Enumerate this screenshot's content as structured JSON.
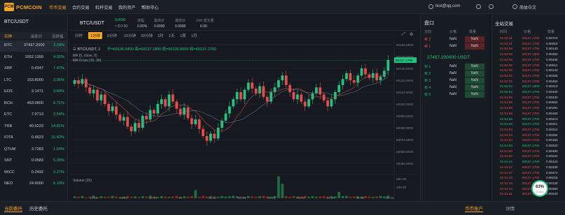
{
  "app": {
    "logo_text": "PCMCOIN",
    "logo_mark": "PCM"
  },
  "nav": [
    "币币交易",
    "合约交易",
    "杠杆交易",
    "我的资产",
    "帮助中心"
  ],
  "nav_active_index": 0,
  "header_right": {
    "user": "test@qq.com",
    "lang": "简体中文",
    "extra": ""
  },
  "market": {
    "title": "BTC/USDT",
    "headers": [
      "币种",
      "最新价",
      "涨跌幅"
    ],
    "rows": [
      {
        "coin": "BTC",
        "price": "37497.2000",
        "change": "2.24%"
      },
      {
        "coin": "ETH",
        "price": "1652.1300",
        "change": "4.92%"
      },
      {
        "coin": "XRP",
        "price": "0.4347",
        "change": "7.47%"
      },
      {
        "coin": "LTC",
        "price": "153.8000",
        "change": "3.05%"
      },
      {
        "coin": "EOS",
        "price": "3.1471",
        "change": "3.69%"
      },
      {
        "coin": "BCH",
        "price": "463.0800",
        "change": "6.71%"
      },
      {
        "coin": "ETC",
        "price": "7.9713",
        "change": "3.54%"
      },
      {
        "coin": "TRB",
        "price": "40.5223",
        "change": "14.81%"
      },
      {
        "coin": "IOTA",
        "price": "0.4823",
        "change": "15.42%"
      },
      {
        "coin": "QTUM",
        "price": "3.7383",
        "change": "1.64%"
      },
      {
        "coin": "SNT",
        "price": "0.0583",
        "change": "5.39%"
      },
      {
        "coin": "WICC",
        "price": "0.2492",
        "change": "3.27%"
      },
      {
        "coin": "NEO",
        "price": "24.6000",
        "change": "6.19%"
      }
    ]
  },
  "pair": {
    "title": "BTC/USDT",
    "price": "0.0000",
    "price_usd": "≈ $ 0.00",
    "stats": [
      {
        "k": "涨幅",
        "v": "0.00%"
      },
      {
        "k": "最高价",
        "v": "0.0000"
      },
      {
        "k": "最低价",
        "v": "0.0000"
      },
      {
        "k": "24H 成交量",
        "v": "0.00"
      }
    ]
  },
  "timeframes": [
    "分时",
    "1分钟",
    "5分钟",
    "15分钟",
    "30分钟",
    "1时",
    "1天",
    "1周",
    "1月"
  ],
  "timeframe_active_index": 1,
  "tv": {
    "legend": "BTC/USDT, 1",
    "ohlc": "开=60136.5400 高=60137.1800 低=60135.8600 收=60137.1700",
    "ma1": "MA (5, close, 0)",
    "ma2": "MA Cross (10, 30)",
    "volume": "Volume (20)"
  },
  "chart_data": {
    "type": "candlestick",
    "y_ticks": [
      "60150.0000",
      "60140.0000",
      "60130.0000",
      "60120.0000",
      "60110.0000",
      "60100.0000",
      "60090.0000",
      "60080.0000",
      "60070.0000",
      "60060.0000",
      "60050.0000"
    ],
    "vol_ticks": [
      "200.00",
      "100.00"
    ],
    "x_ticks": [
      "23:15",
      "23:30",
      "23:45",
      "06",
      "00:15",
      "00:30",
      "00:45",
      "01:00",
      "01:15",
      "01:30",
      "01:45"
    ],
    "last_price_tag": "60137.1700",
    "closes": [
      60120,
      60117,
      60121,
      60114,
      60109,
      60112,
      60103,
      60108,
      60100,
      60094,
      60098,
      60091,
      60086,
      60089,
      60081,
      60077,
      60084,
      60080,
      60090,
      60087,
      60095,
      60092,
      60100,
      60104,
      60098,
      60108,
      60102,
      60096,
      60091,
      60097,
      60088,
      60083,
      60087,
      60079,
      60073,
      60069,
      60075,
      60071,
      60080,
      60086,
      60092,
      60098,
      60104,
      60110,
      60104,
      60112,
      60118,
      60113,
      60109,
      60115,
      60106,
      60102,
      60110,
      60114,
      60120,
      60124,
      60116,
      60110,
      60104,
      60108,
      60102,
      60098,
      60104,
      60109,
      60114,
      60108,
      60103,
      60098,
      60104,
      60110,
      60116,
      60121,
      60126,
      60120,
      60118,
      60124,
      60130,
      60125,
      60122,
      60126,
      60120,
      60123,
      60128,
      60137
    ],
    "volumes": [
      10,
      8,
      12,
      6,
      9,
      14,
      7,
      11,
      9,
      8,
      13,
      10,
      6,
      9,
      12,
      8,
      10,
      7,
      11,
      9,
      14,
      10,
      8,
      12,
      9,
      7,
      10,
      13,
      8,
      11,
      9,
      12,
      10,
      8,
      14,
      9,
      11,
      10,
      8,
      12,
      9,
      10,
      13,
      11,
      9,
      8,
      12,
      10,
      9,
      11,
      13,
      10,
      8,
      12,
      9,
      10,
      11,
      8,
      12,
      9,
      10,
      13,
      9,
      11,
      8,
      10,
      12,
      9,
      11,
      10,
      8,
      12,
      13,
      9,
      10,
      11,
      9,
      12,
      10,
      8,
      11,
      13,
      10,
      14
    ],
    "vol_spikes": [
      {
        "i": 54,
        "v": 120
      },
      {
        "i": 55,
        "v": 80
      },
      {
        "i": 32,
        "v": 45
      },
      {
        "i": 70,
        "v": 35
      }
    ]
  },
  "orderbook": {
    "title": "盘口",
    "headers": [
      "方向",
      "价格",
      "数量"
    ],
    "asks": [
      {
        "n": "卖 2",
        "p": "NaN",
        "a": "NaN"
      },
      {
        "n": "卖 1",
        "p": "NaN",
        "a": "NaN"
      }
    ],
    "last": "37497.200000 USDT",
    "bids": [
      {
        "n": "买 1",
        "p": "NaN",
        "a": "NaN"
      },
      {
        "n": "买 2",
        "p": "NaN",
        "a": "NaN"
      },
      {
        "n": "买 3",
        "p": "NaN",
        "a": "NaN"
      },
      {
        "n": "买 4",
        "p": "NaN",
        "a": "NaN"
      },
      {
        "n": "买 5",
        "p": "NaN",
        "a": "NaN"
      }
    ]
  },
  "trades": {
    "title": "全站交易",
    "headers": [
      "时间",
      "价格",
      "数量"
    ],
    "rows": [
      {
        "s": "sell",
        "t": "01:52:11",
        "p": "60137.1700",
        "q": "0.00710"
      },
      {
        "s": "sell",
        "t": "01:52:11",
        "p": "60137.1700",
        "q": "0.00910"
      },
      {
        "s": "sell",
        "t": "01:52:08",
        "p": "60137.1700",
        "q": "0.00143"
      },
      {
        "s": "sell",
        "t": "01:52:08",
        "p": "60137.1800",
        "q": "0.00352"
      },
      {
        "s": "sell",
        "t": "01:52:08",
        "p": "60137.1700",
        "q": "0.00430"
      },
      {
        "s": "sell",
        "t": "01:52:05",
        "p": "60137.1700",
        "q": "0.00611"
      },
      {
        "s": "sell",
        "t": "01:52:05",
        "p": "60137.1700",
        "q": "0.00140"
      },
      {
        "s": "sell",
        "t": "01:52:05",
        "p": "60137.1700",
        "q": "0.00325"
      },
      {
        "s": "sell",
        "t": "01:52:02",
        "p": "60137.1700",
        "q": "0.00452"
      },
      {
        "s": "buy",
        "t": "01:52:02",
        "p": "60137.1800",
        "q": "0.00210"
      },
      {
        "s": "buy",
        "t": "01:52:02",
        "p": "60137.1700",
        "q": "0.00100"
      },
      {
        "s": "sell",
        "t": "01:51:59",
        "p": "60137.1700",
        "q": "0.00432"
      },
      {
        "s": "sell",
        "t": "01:51:59",
        "p": "60137.1700",
        "q": "0.00652"
      },
      {
        "s": "sell",
        "t": "01:51:59",
        "p": "60137.1700",
        "q": "0.00291"
      },
      {
        "s": "sell",
        "t": "01:51:56",
        "p": "60137.1700",
        "q": "0.00160"
      },
      {
        "s": "buy",
        "t": "01:51:56",
        "p": "60137.1700",
        "q": "0.00413"
      },
      {
        "s": "buy",
        "t": "01:51:56",
        "p": "60137.1700",
        "q": "0.00211"
      },
      {
        "s": "sell",
        "t": "01:51:53",
        "p": "60137.1700",
        "q": "0.00312"
      },
      {
        "s": "sell",
        "t": "01:51:53",
        "p": "60137.1700",
        "q": "0.00254"
      },
      {
        "s": "sell",
        "t": "01:51:53",
        "p": "60137.1700",
        "q": "0.00150"
      },
      {
        "s": "buy",
        "t": "01:51:50",
        "p": "60137.1700",
        "q": "0.00320"
      },
      {
        "s": "sell",
        "t": "01:51:50",
        "p": "60137.1700",
        "q": "0.00490"
      },
      {
        "s": "sell",
        "t": "01:51:50",
        "p": "60137.1700",
        "q": "0.00241"
      },
      {
        "s": "buy",
        "t": "01:51:47",
        "p": "60137.1700",
        "q": "0.00123"
      },
      {
        "s": "sell",
        "t": "01:51:47",
        "p": "60137.1700",
        "q": "0.00330"
      },
      {
        "s": "sell",
        "t": "01:51:47",
        "p": "60137.1700",
        "q": "0.00471"
      },
      {
        "s": "sell",
        "t": "01:51:44",
        "p": "60137.1700",
        "q": "0.00215"
      },
      {
        "s": "sell",
        "t": "01:51:44",
        "p": "60137.1700",
        "q": "0.00130"
      },
      {
        "s": "sell",
        "t": "01:51:44",
        "p": "60137.1700",
        "q": "0.00360"
      },
      {
        "s": "sell",
        "t": "01:51:41",
        "p": "60137.1700",
        "q": "0.00240"
      }
    ]
  },
  "bottom": {
    "tab1": "当前委托",
    "tab2": "历史委托",
    "tab3": "币币账户",
    "tab4": "详情"
  },
  "gauge": {
    "pct": "63%",
    "sub": "0.1k/s"
  },
  "colors": {
    "accent": "#f5a524",
    "up": "#26c281",
    "down": "#e74c4c"
  }
}
